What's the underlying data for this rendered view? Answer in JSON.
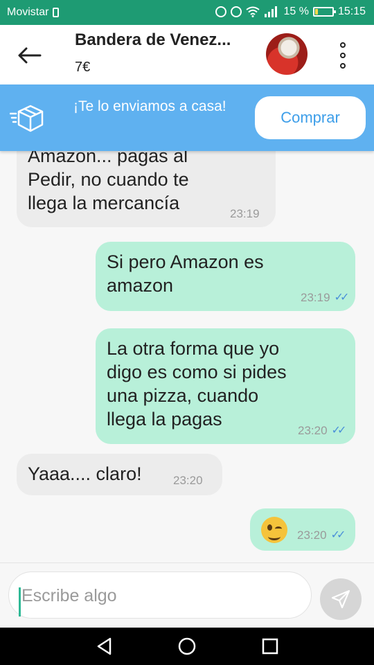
{
  "status_bar": {
    "carrier": "Movistar",
    "battery": "15 %",
    "time": "15:15"
  },
  "header": {
    "title": "Bandera de Venez...",
    "price": "7€",
    "back_icon": "arrow-left-icon",
    "menu_icon": "more-vert-icon"
  },
  "banner": {
    "text": "¡Te lo enviamos a casa!",
    "button_label": "Comprar",
    "icon": "delivery-box-icon"
  },
  "messages": [
    {
      "side": "in",
      "text": "Amazon... pagas al\nPedir, no cuando te\nllega la mercancía",
      "time": "23:19"
    },
    {
      "side": "out",
      "text": "Si pero Amazon es\namazon",
      "time": "23:19",
      "read": true
    },
    {
      "side": "out",
      "text": "La otra forma que yo\ndigo es como si pides\nuna pizza, cuando\nllega la pagas",
      "time": "23:20",
      "read": true
    },
    {
      "side": "in",
      "text": "Yaaa.... claro!",
      "time": "23:20"
    },
    {
      "side": "out",
      "text": "",
      "emoji": "winking-face",
      "time": "23:20",
      "read": true
    }
  ],
  "composer": {
    "placeholder": "Escribe algo",
    "send_icon": "send-icon"
  },
  "colors": {
    "status_bar": "#1e9b73",
    "banner": "#5fb1f0",
    "outgoing_bubble": "#b8f0d9",
    "incoming_bubble": "#ececec",
    "accent": "#2fb996"
  }
}
